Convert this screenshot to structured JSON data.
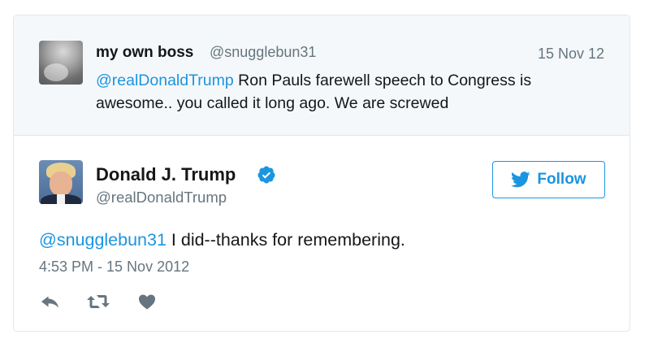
{
  "parent_tweet": {
    "author_name": "my own boss",
    "author_handle": "@snugglebun31",
    "date": "15 Nov 12",
    "mention": "@realDonaldTrump",
    "text": " Ron Pauls farewell speech to Congress is awesome.. you called it long ago. We are screwed"
  },
  "tweet": {
    "author_name": "Donald J. Trump",
    "author_handle": "@realDonaldTrump",
    "verified_icon": "verified-badge-icon",
    "follow_label": "Follow",
    "follow_icon": "twitter-bird-icon",
    "mention": "@snugglebun31",
    "text": " I did--thanks for remembering.",
    "timestamp": "4:53 PM - 15 Nov 2012"
  },
  "actions": [
    {
      "icon": "reply-icon"
    },
    {
      "icon": "retweet-icon"
    },
    {
      "icon": "like-heart-icon"
    }
  ],
  "colors": {
    "accent": "#1b95e0",
    "muted_text": "#66757f",
    "parent_background": "#f5f8fa",
    "action_icon": "#66757f"
  }
}
